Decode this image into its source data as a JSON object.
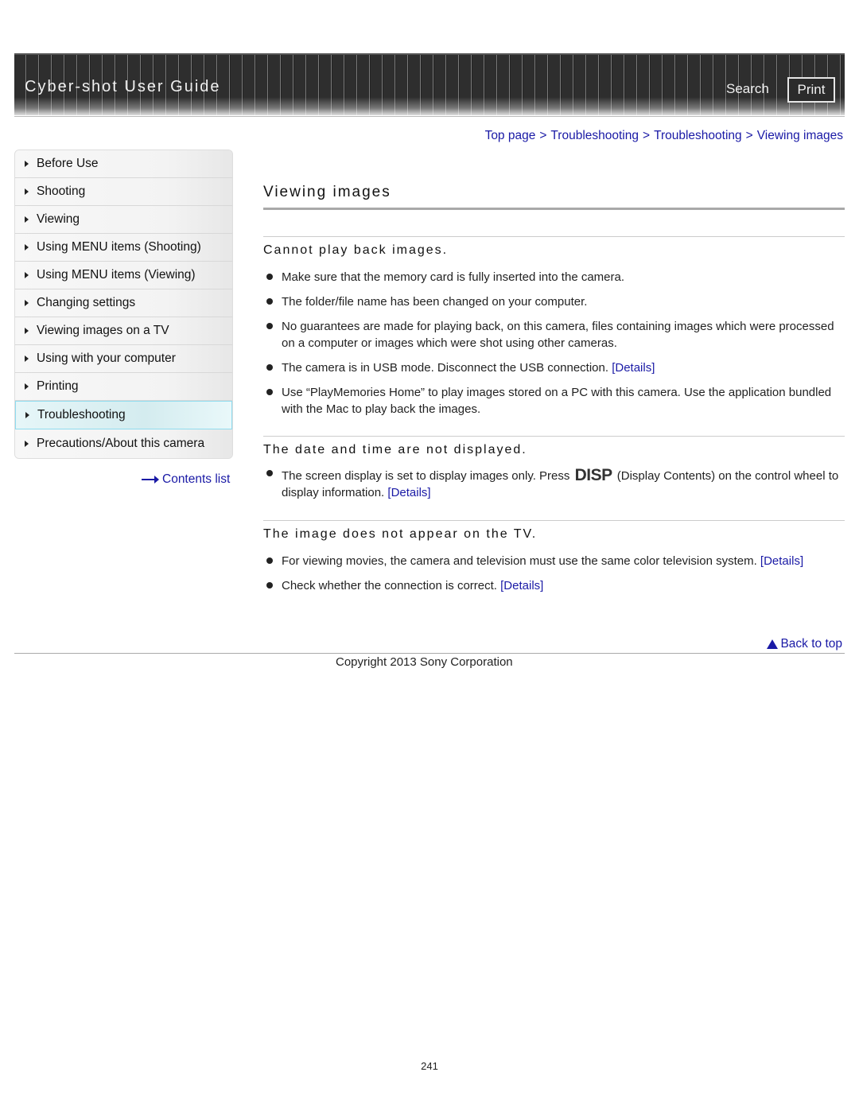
{
  "header": {
    "title": "Cyber-shot User Guide",
    "search_label": "Search",
    "print_label": "Print"
  },
  "breadcrumb": [
    {
      "label": "Top page"
    },
    {
      "label": "Troubleshooting"
    },
    {
      "label": "Troubleshooting"
    },
    {
      "label": "Viewing images"
    }
  ],
  "breadcrumb_separator": ">",
  "sidebar": {
    "items": [
      {
        "label": "Before Use"
      },
      {
        "label": "Shooting"
      },
      {
        "label": "Viewing"
      },
      {
        "label": "Using MENU items (Shooting)"
      },
      {
        "label": "Using MENU items (Viewing)"
      },
      {
        "label": "Changing settings"
      },
      {
        "label": "Viewing images on a TV"
      },
      {
        "label": "Using with your computer"
      },
      {
        "label": "Printing"
      },
      {
        "label": "Troubleshooting",
        "active": true
      },
      {
        "label": "Precautions/About this camera"
      }
    ],
    "contents_link": "Contents list"
  },
  "main": {
    "title": "Viewing images",
    "sections": [
      {
        "title": "Cannot play back images.",
        "bullets": [
          {
            "text": "Make sure that the memory card is fully inserted into the camera."
          },
          {
            "text": "The folder/file name has been changed on your computer."
          },
          {
            "text": "No guarantees are made for playing back, on this camera, files containing images which were processed on a computer or images which were shot using other cameras."
          },
          {
            "text": "The camera is in USB mode. Disconnect the USB connection. ",
            "link": "[Details]"
          },
          {
            "text": "Use “PlayMemories Home” to play images stored on a PC with this camera. Use the application bundled with the Mac to play back the images."
          }
        ]
      },
      {
        "title": "The date and time are not displayed.",
        "bullets": [
          {
            "text_before": "The screen display is set to display images only. Press ",
            "icon": "DISP",
            "text_after": " (Display Contents) on the control wheel to display information. ",
            "link": "[Details]"
          }
        ]
      },
      {
        "title": "The image does not appear on the TV.",
        "bullets": [
          {
            "text": "For viewing movies, the camera and television must use the same color television system. ",
            "link": "[Details]"
          },
          {
            "text": "Check whether the connection is correct. ",
            "link": "[Details]"
          }
        ]
      }
    ]
  },
  "footer": {
    "back_to_top": "Back to top",
    "copyright": "Copyright 2013 Sony Corporation",
    "page_number": "241"
  },
  "colors": {
    "link": "#1a1aa6",
    "header_bg": "#2a2a2a",
    "active_item_bg": "#d4ecef",
    "active_item_border": "#8fdcef"
  }
}
